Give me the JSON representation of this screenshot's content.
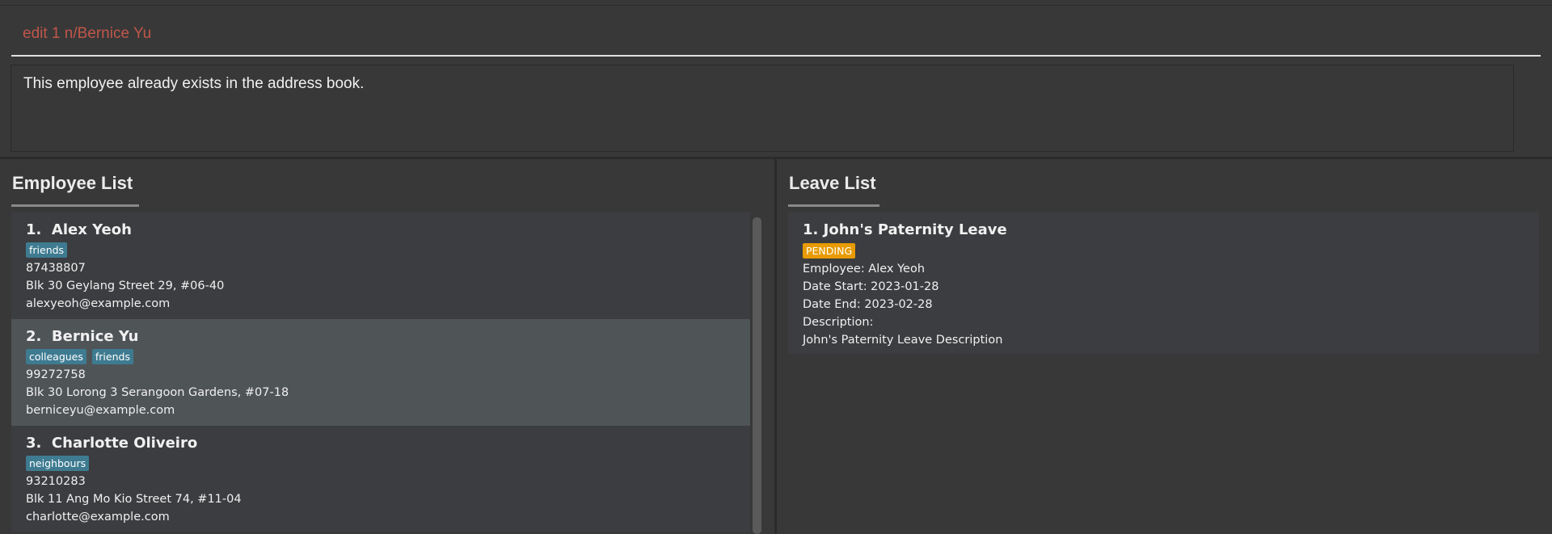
{
  "command": {
    "value": "edit 1 n/Bernice Yu"
  },
  "result": {
    "message": "This employee already exists in the address book."
  },
  "employee_panel": {
    "title": "Employee List",
    "employees": [
      {
        "index": "1.",
        "name": "Alex Yeoh",
        "tags": [
          "friends"
        ],
        "phone": "87438807",
        "address": "Blk 30 Geylang Street 29, #06-40",
        "email": "alexyeoh@example.com"
      },
      {
        "index": "2.",
        "name": "Bernice Yu",
        "tags": [
          "colleagues",
          "friends"
        ],
        "phone": "99272758",
        "address": "Blk 30 Lorong 3 Serangoon Gardens, #07-18",
        "email": "berniceyu@example.com"
      },
      {
        "index": "3.",
        "name": "Charlotte Oliveiro",
        "tags": [
          "neighbours"
        ],
        "phone": "93210283",
        "address": "Blk 11 Ang Mo Kio Street 74, #11-04",
        "email": "charlotte@example.com"
      }
    ]
  },
  "leave_panel": {
    "title": "Leave List",
    "leaves": [
      {
        "title": "1.  John's Paternity Leave",
        "status": "PENDING",
        "employee": "Employee: Alex Yeoh",
        "start": "Date Start: 2023-01-28",
        "end": "Date End: 2023-02-28",
        "desc_label": "Description:",
        "description": "John's Paternity Leave Description"
      }
    ]
  },
  "colors": {
    "tag": "#3e7b91",
    "pending": "#e79b00",
    "command_text": "#c0564a"
  }
}
